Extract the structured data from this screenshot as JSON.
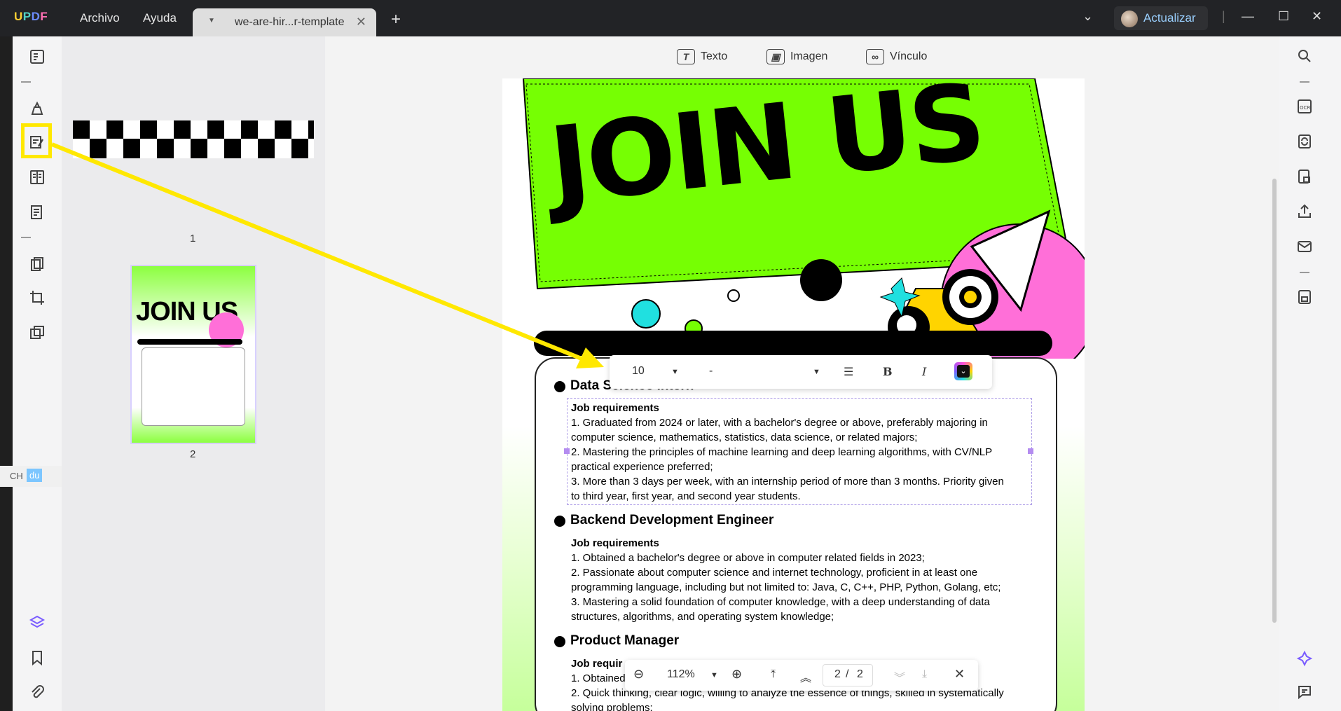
{
  "titlebar": {
    "menu": [
      "Archivo",
      "Ayuda"
    ],
    "tab_title": "we-are-hir...r-template",
    "upgrade_label": "Actualizar"
  },
  "edit_toolbar": {
    "text_label": "Texto",
    "image_label": "Imagen",
    "link_label": "Vínculo"
  },
  "thumbnails": {
    "page1_label": "1",
    "page2_label": "2"
  },
  "format_bar": {
    "font_size": "10",
    "font_name": "-"
  },
  "zoom_bar": {
    "zoom": "112%",
    "current_page": "2",
    "separator": "/",
    "total_pages": "2"
  },
  "ime": {
    "mode": "CH",
    "app": "du"
  },
  "document": {
    "headline": "JOIN US",
    "sections": [
      {
        "title": "Data Science Intern",
        "heading": "Job requirements",
        "lines": [
          "1. Graduated from 2024 or later, with a bachelor's degree or above, preferably majoring in",
          "computer science, mathematics, statistics, data science, or related majors;",
          "2. Mastering the principles of machine learning and deep learning algorithms, with CV/NLP",
          "practical experience preferred;",
          "3. More than 3 days per week, with an internship period of more than 3 months. Priority given",
          "to third year, first year, and second year students."
        ]
      },
      {
        "title": "Backend Development Engineer",
        "heading": "Job requirements",
        "lines": [
          "1. Obtained a bachelor's degree or above in computer related fields in 2023;",
          "2. Passionate about computer science and internet technology, proficient in at least one",
          "programming language, including but not limited to: Java, C, C++, PHP, Python, Golang, etc;",
          "3. Mastering a solid foundation of computer knowledge, with a deep understanding of data",
          "structures, algorithms, and operating system knowledge;"
        ]
      },
      {
        "title": "Product Manager",
        "heading": "Job requir",
        "lines": [
          "1. Obtained",
          "2. Quick thinking, clear logic, willing to analyze the essence of things, skilled in systematically",
          "solving problems;"
        ]
      }
    ]
  },
  "colors": {
    "accent": "#ffe800",
    "brand_green": "#76ff03",
    "pink": "#ff6fd8",
    "cyan": "#20e0e0",
    "yellow_shape": "#ffd400"
  }
}
